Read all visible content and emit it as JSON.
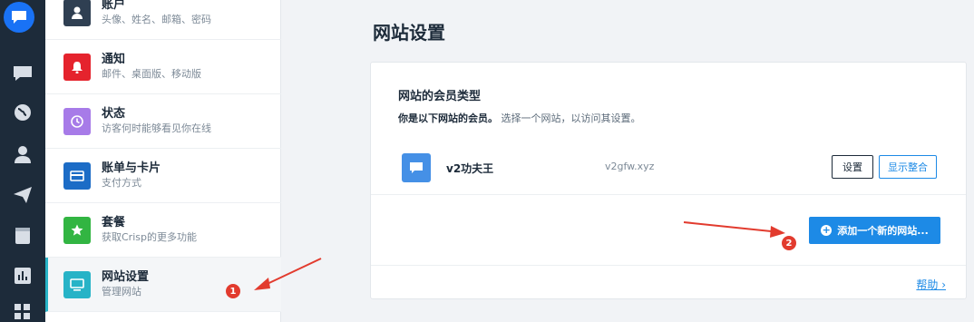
{
  "menu": {
    "items": [
      {
        "title": "账户",
        "sub": "头像、姓名、邮箱、密码",
        "color": "#2f3f52",
        "icon": "user-icon"
      },
      {
        "title": "通知",
        "sub": "邮件、桌面版、移动版",
        "color": "#e5232d",
        "icon": "bell-icon"
      },
      {
        "title": "状态",
        "sub": "访客何时能够看见你在线",
        "color": "#a77be8",
        "icon": "clock-icon"
      },
      {
        "title": "账单与卡片",
        "sub": "支付方式",
        "color": "#1c6cc6",
        "icon": "card-icon"
      },
      {
        "title": "套餐",
        "sub": "获取Crisp的更多功能",
        "color": "#32b542",
        "icon": "star-icon"
      },
      {
        "title": "网站设置",
        "sub": "管理网站",
        "color": "#27b3c7",
        "icon": "monitor-icon"
      }
    ]
  },
  "main": {
    "title": "网站设置",
    "section_title": "网站的会员类型",
    "section_desc_bold": "你是以下网站的会员。",
    "section_desc_rest": " 选择一个网站，以访问其设置。",
    "site": {
      "name": "v2功夫王",
      "domain": "v2gfw.xyz"
    },
    "settings_button": "设置",
    "integrate_button": "显示整合",
    "add_button": "添加一个新的网站...",
    "help_link": "帮助 ›"
  },
  "annotations": {
    "badge1": "1",
    "badge2": "2",
    "arrow_color": "#e23b2e"
  },
  "colors": {
    "rail": "#1d2b3a",
    "accent": "#1d8ae6",
    "logo": "#1972f5"
  }
}
